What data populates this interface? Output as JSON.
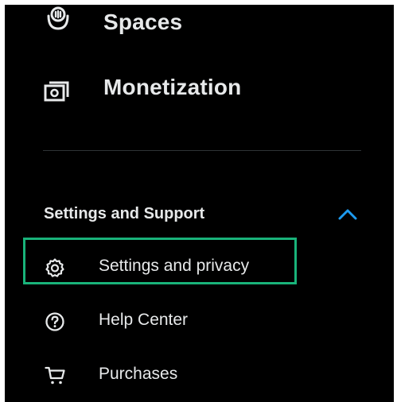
{
  "menu": {
    "items": [
      {
        "label": "Spaces",
        "icon": "spaces-icon"
      },
      {
        "label": "Monetization",
        "icon": "monetization-icon"
      }
    ],
    "section": {
      "title": "Settings and Support",
      "expanded": true,
      "chevron_color": "#1d9bf0",
      "items": [
        {
          "label": "Settings and privacy",
          "icon": "gear-icon",
          "highlighted": true
        },
        {
          "label": "Help Center",
          "icon": "help-icon"
        },
        {
          "label": "Purchases",
          "icon": "cart-icon"
        }
      ]
    }
  },
  "colors": {
    "background": "#000000",
    "text": "#e7e9ea",
    "divider": "#2f3336",
    "highlight_border": "#19b37a"
  }
}
